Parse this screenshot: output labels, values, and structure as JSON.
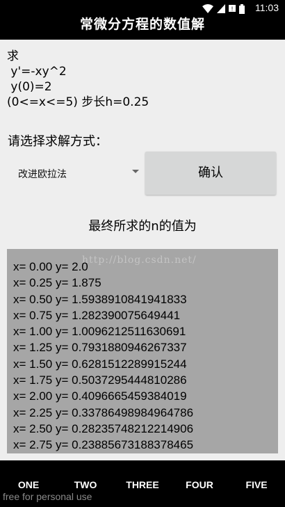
{
  "status_bar": {
    "time": "11:03",
    "icons": [
      "wifi-icon",
      "signal-icon",
      "sms-icon",
      "battery-icon"
    ]
  },
  "app": {
    "title": "常微分方程的数值解"
  },
  "problem": {
    "line1": "求",
    "line2": " y'=-xy^2",
    "line3": " y(0)=2",
    "line4": "(0<=x<=5) 步长h=0.25"
  },
  "method": {
    "label": "请选择求解方式：",
    "selected": "改进欧拉法"
  },
  "confirm_button": "确认",
  "result": {
    "heading": "最终所求的n的值为",
    "watermark": "http://blog.csdn.net/",
    "rows": [
      "x= 0.00 y= 2.0",
      "x= 0.25 y= 1.875",
      "x= 0.50 y= 1.593891084194183​3",
      "x= 0.75 y= 1.282390075649441",
      "x= 1.00 y= 1.0096212511630691",
      "x= 1.25 y= 0.7931880946267337",
      "x= 1.50 y= 0.6281512289915244",
      "x= 1.75 y= 0.5037295444810286",
      "x= 2.00 y= 0.4096665459384019",
      "x= 2.25 y= 0.33786498984964786",
      "x= 2.50 y= 0.28235748212214906",
      "x= 2.75 y= 0.23885673188378465"
    ]
  },
  "tabs": [
    "ONE",
    "TWO",
    "THREE",
    "FOUR",
    "FIVE"
  ],
  "footer_note": "free for personal use",
  "colors": {
    "background": "#eeeeee",
    "result_area": "#a6a6a6",
    "button": "#d6d7d7",
    "bars": "#000000"
  }
}
